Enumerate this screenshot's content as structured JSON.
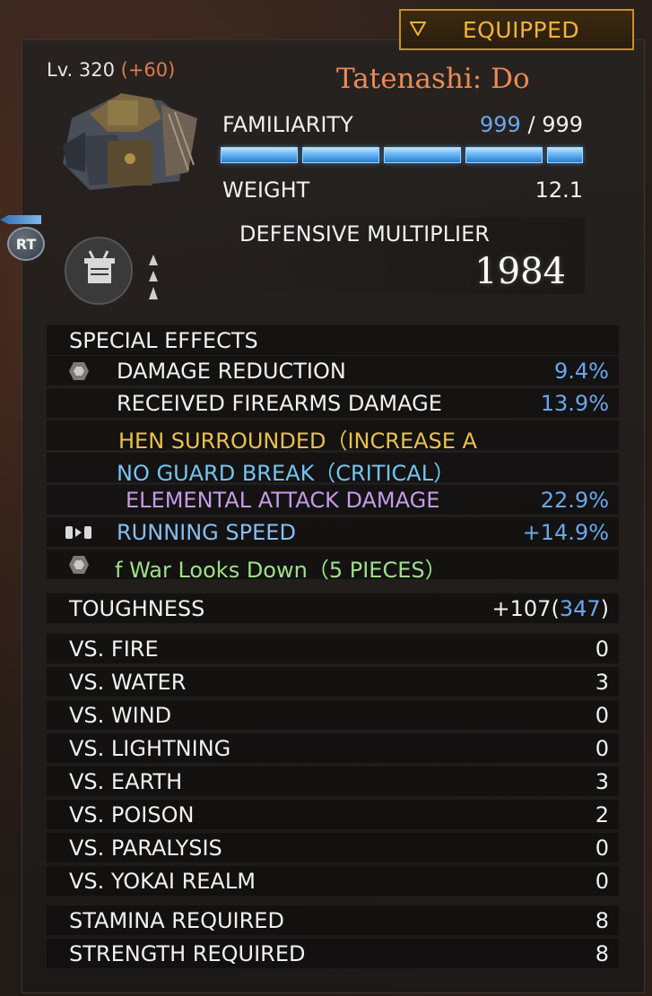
{
  "header": {
    "equipped_label": "EQUIPPED",
    "level": "Lv. 320",
    "level_bonus": "(+60)",
    "item_name": "Tatenashi: Do"
  },
  "stats": {
    "familiarity_label": "FAMILIARITY",
    "familiarity_current": "999",
    "familiarity_sep": "/",
    "familiarity_max": "999",
    "familiarity_fraction": 1.0,
    "weight_label": "WEIGHT",
    "weight_value": "12.1",
    "def_label": "DEFENSIVE MULTIPLIER",
    "def_value": "1984"
  },
  "controls": {
    "rt_label": "RT"
  },
  "special_effects": {
    "title": "SPECIAL EFFECTS",
    "items": [
      {
        "label": "DAMAGE REDUCTION",
        "value": "9.4%",
        "color": "#f1f1f1",
        "icon": "hexagon-icon"
      },
      {
        "label": "RECEIVED FIREARMS DAMAGE",
        "value": "13.9%",
        "color": "#f1f1f1",
        "icon": ""
      },
      {
        "label": "HEN SURROUNDED（INCREASE A",
        "value": "",
        "color": "#ecc04a",
        "icon": ""
      },
      {
        "label": "NO GUARD BREAK（CRITICAL）",
        "value": "",
        "color": "#73c5ef",
        "icon": ""
      },
      {
        "label": "ELEMENTAL ATTACK DAMAGE",
        "value": "22.9%",
        "color": "#c59be8",
        "icon": ""
      },
      {
        "label": "RUNNING SPEED",
        "value": "+14.9%",
        "color": "#85bff2",
        "icon": "running-speed-icon"
      },
      {
        "label": "f War Looks Down（5 PIECES）",
        "value": "",
        "color": "#9fe08a",
        "icon": "hexagon-icon"
      }
    ]
  },
  "toughness": {
    "label": "TOUGHNESS",
    "value_prefix": "+107(",
    "value_blue": "347",
    "value_suffix": ")"
  },
  "resistances": [
    {
      "label": "VS. FIRE",
      "value": "0"
    },
    {
      "label": "VS. WATER",
      "value": "3"
    },
    {
      "label": "VS. WIND",
      "value": "0"
    },
    {
      "label": "VS. LIGHTNING",
      "value": "0"
    },
    {
      "label": "VS. EARTH",
      "value": "3"
    },
    {
      "label": "VS. POISON",
      "value": "2"
    },
    {
      "label": "VS. PARALYSIS",
      "value": "0"
    },
    {
      "label": "VS. YOKAI REALM",
      "value": "0"
    }
  ],
  "requirements": [
    {
      "label": "STAMINA REQUIRED",
      "value": "8"
    },
    {
      "label": "STRENGTH REQUIRED",
      "value": "8"
    }
  ]
}
